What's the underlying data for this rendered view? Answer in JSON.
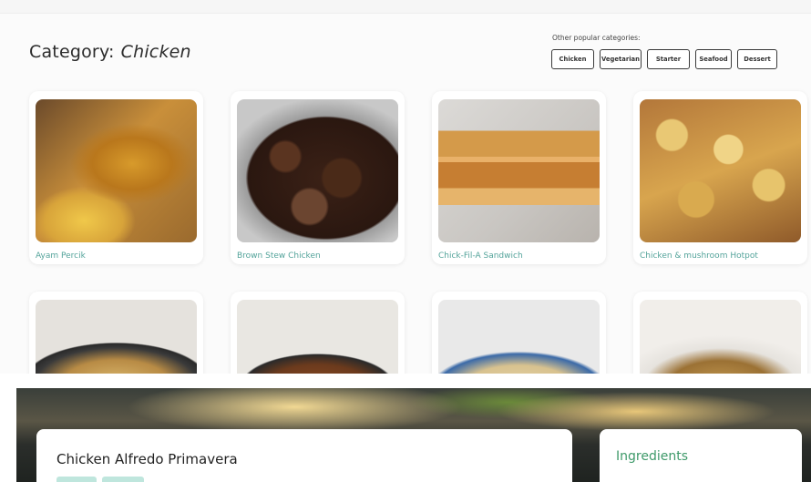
{
  "category": {
    "label": "Category:",
    "value": "Chicken"
  },
  "popular": {
    "label": "Other popular categories:",
    "items": [
      "Chicken",
      "Vegetarian",
      "Starter",
      "Seafood",
      "Dessert"
    ]
  },
  "meals_row1": [
    {
      "name": "Ayam Percik",
      "image": "ayam-percik-photo"
    },
    {
      "name": "Brown Stew Chicken",
      "image": "brown-stew-chicken-photo"
    },
    {
      "name": "Chick-Fil-A Sandwich",
      "image": "chick-fil-a-sandwich-photo"
    },
    {
      "name": "Chicken & mushroom Hotpot",
      "image": "chicken-mushroom-hotpot-photo"
    }
  ],
  "meals_row2": [
    {
      "image": "pasta-skillet-photo"
    },
    {
      "image": "pan-dish-photo"
    },
    {
      "image": "soup-bowl-photo"
    },
    {
      "image": "baked-dish-photo"
    }
  ],
  "recipe": {
    "title": "Chicken Alfredo Primavera",
    "ingredients_label": "Ingredients"
  },
  "colors": {
    "accent": "#53a39a",
    "ingredients_heading": "#3f9a6a",
    "tag_background": "#bfe6dd"
  }
}
